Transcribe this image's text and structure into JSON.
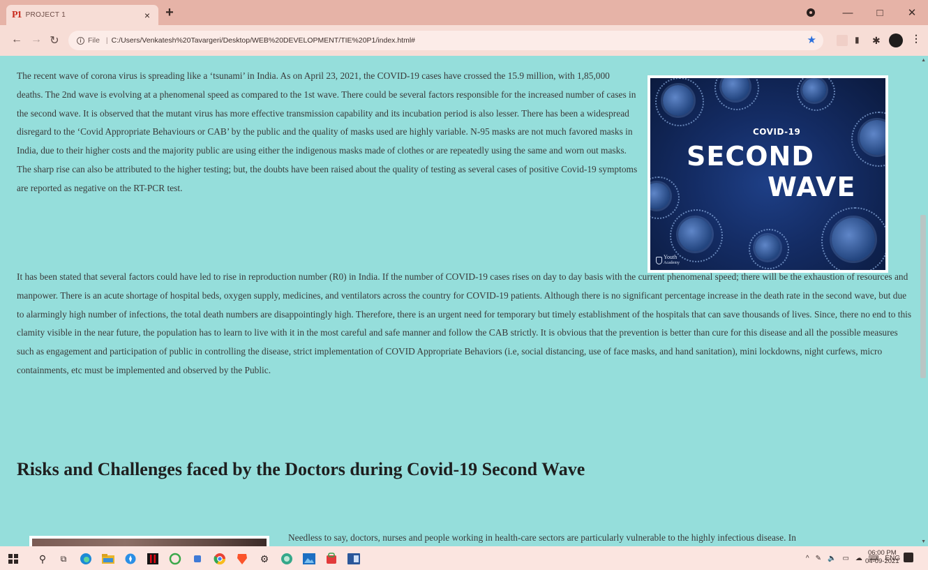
{
  "browser": {
    "tab": {
      "favicon": "P1",
      "title": "PROJECT 1",
      "close_icon": "×"
    },
    "new_tab_icon": "+",
    "address": {
      "info_icon": "i",
      "scheme_label": "File",
      "separator": "|",
      "url": "C:/Users/Venkatesh%20Tavargeri/Desktop/WEB%20DEVELOPMENT/TIE%20P1/index.html#"
    },
    "window_controls": {
      "minimize": "—",
      "maximize": "□",
      "close": "✕"
    }
  },
  "page": {
    "paragraph_1": "The recent wave of corona virus is spreading like a ‘tsunami’ in India. As on April 23, 2021, the COVID-19 cases have crossed the 15.9 million, with 1,85,000 deaths. The 2nd wave is evolving at a phenomenal speed as compared to the 1st wave. There could be several factors responsible for the increased number of cases in the second wave. It is observed that the mutant virus has more effective transmission capability and its incubation period is also lesser. There has been a widespread disregard to the ‘Covid Appropriate Behaviours or CAB’ by the public and the quality of masks used are highly variable. N-95 masks are not much favored masks in India, due to their higher costs and the majority public are using either the indigenous masks made of clothes or are repeatedly using the same and worn out masks. The sharp rise can also be attributed to the higher testing; but, the doubts have been raised about the quality of testing as several cases of positive Covid-19 symptoms are reported as negative on the RT-PCR test.",
    "paragraph_2": "It has been stated that several factors could have led to rise in reproduction number (R0) in India. If the number of COVID-19 cases rises on day to day basis with the current phenomenal speed; there will be the exhaustion of resources and manpower. There is an acute shortage of hospital beds, oxygen supply, medicines, and ventilators across the country for COVID-19 patients. Although there is no significant percentage increase in the death rate in the second wave, but due to alarmingly high number of infections, the total death numbers are disappointingly high. Therefore, there is an urgent need for temporary but timely establishment of the hospitals that can save thousands of lives. Since, there no end to this clamity visible in the near future, the population has to learn to live with it in the most careful and safe manner and follow the CAB strictly. It is obvious that the prevention is better than cure for this disease and all the possible measures such as engagement and participation of public in controlling the disease, strict implementation of COVID Appropriate Behaviors (i.e, social distancing, use of face masks, and hand sanitation), mini lockdowns, night curfews, micro containments, etc must be implemented and observed by the Public.",
    "hero_image": {
      "tag": "COVID-19",
      "line_1": "SECOND",
      "line_2": "WAVE",
      "logo_line_1": "Youth",
      "logo_line_2": "Academy"
    },
    "heading": "Risks and Challenges faced by the Doctors during Covid-19 Second Wave",
    "paragraph_3": "Needless to say, doctors, nurses and people working in health-care sectors are particularly vulnerable to the highly infectious disease. In"
  },
  "taskbar": {
    "tray": [
      "^",
      "ENG"
    ],
    "time": "06:00 PM",
    "date": "04-09-2021"
  },
  "colors": {
    "page_background": "#95dedb",
    "browser_frame": "#e6b3a7",
    "taskbar": "#fbe5e0"
  }
}
